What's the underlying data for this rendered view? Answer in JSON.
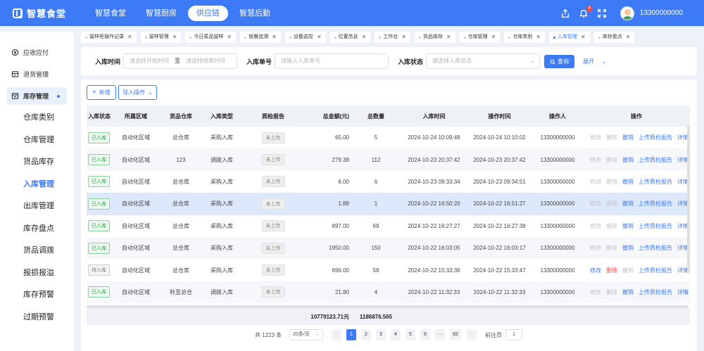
{
  "app": {
    "name": "智慧食堂"
  },
  "topnav": [
    {
      "label": "智慧食堂",
      "active": false
    },
    {
      "label": "智慧厨房",
      "active": false
    },
    {
      "label": "供应链",
      "active": true
    },
    {
      "label": "智慧后勤",
      "active": false
    }
  ],
  "header": {
    "notification_count": "4",
    "user_phone": "13300000000"
  },
  "sidebar": {
    "items": [
      {
        "label": "应收应付",
        "icon": "money-icon"
      },
      {
        "label": "退货管理",
        "icon": "return-icon"
      },
      {
        "label": "库存管理",
        "icon": "inventory-icon",
        "expanded": true
      }
    ],
    "sub_items": [
      {
        "label": "仓库类别",
        "active": false
      },
      {
        "label": "仓库管理",
        "active": false
      },
      {
        "label": "货品库存",
        "active": false
      },
      {
        "label": "入库管理",
        "active": true
      },
      {
        "label": "出库管理",
        "active": false
      },
      {
        "label": "库存盘点",
        "active": false
      },
      {
        "label": "货品调拨",
        "active": false
      },
      {
        "label": "报损报溢",
        "active": false
      },
      {
        "label": "库存预警",
        "active": false
      },
      {
        "label": "过期预警",
        "active": false
      }
    ]
  },
  "tabs": [
    {
      "label": "留样柜操作记录",
      "active": false
    },
    {
      "label": "留样管理",
      "active": false
    },
    {
      "label": "今日菜品留样",
      "active": false
    },
    {
      "label": "就餐追溯",
      "active": false
    },
    {
      "label": "设备监控",
      "active": false
    },
    {
      "label": "位置信息",
      "active": false
    },
    {
      "label": "工作台",
      "active": false
    },
    {
      "label": "货品库存",
      "active": false
    },
    {
      "label": "仓库管理",
      "active": false
    },
    {
      "label": "仓库类别",
      "active": false
    },
    {
      "label": "入库管理",
      "active": true
    },
    {
      "label": "库存盘点",
      "active": false
    }
  ],
  "search": {
    "date_label": "入库时间",
    "date_start_placeholder": "请选择开始时间",
    "date_to": "至",
    "date_end_placeholder": "请选择结束时间",
    "order_label": "入库单号",
    "order_placeholder": "请输入入库单号",
    "status_label": "入库状态",
    "status_placeholder": "请选择入库状态",
    "query_label": "查询",
    "expand_label": "展开"
  },
  "toolbar": {
    "add_label": "新增",
    "import_label": "导入操作"
  },
  "table": {
    "columns": [
      "入库状态",
      "所属区域",
      "货品仓库",
      "入库类型",
      "质检报告",
      "总金额(元)",
      "总数量",
      "入库时间",
      "操作时间",
      "操作人",
      "操作"
    ],
    "rows": [
      {
        "status": "已入库",
        "area": "自动化区域",
        "warehouse": "总仓库",
        "type": "采购入库",
        "report": "未上传",
        "amount": "65.00",
        "qty": "5",
        "in_time": "2024-10-24 10:09:48",
        "op_time": "2024-10-24 10:10:02",
        "operator": "13300000000",
        "editable": false
      },
      {
        "status": "已入库",
        "area": "自动化区域",
        "warehouse": "123",
        "type": "调拨入库",
        "report": "未上传",
        "amount": "279.38",
        "qty": "112",
        "in_time": "2024-10-23 20:37:42",
        "op_time": "2024-10-23 20:37:42",
        "operator": "13300000000",
        "editable": false
      },
      {
        "status": "已入库",
        "area": "自动化区域",
        "warehouse": "总仓库",
        "type": "采购入库",
        "report": "未上传",
        "amount": "6.00",
        "qty": "6",
        "in_time": "2024-10-23 09:33:34",
        "op_time": "2024-10-23 09:34:51",
        "operator": "13300000000",
        "editable": false
      },
      {
        "status": "已入库",
        "area": "自动化区域",
        "warehouse": "总仓库",
        "type": "采购入库",
        "report": "未上传",
        "amount": "1.88",
        "qty": "1",
        "in_time": "2024-10-22 16:50:20",
        "op_time": "2024-10-22 16:51:27",
        "operator": "13300000000",
        "editable": false
      },
      {
        "status": "已入库",
        "area": "自动化区域",
        "warehouse": "总仓库",
        "type": "采购入库",
        "report": "未上传",
        "amount": "897.00",
        "qty": "69",
        "in_time": "2024-10-22 16:27:27",
        "op_time": "2024-10-22 16:27:38",
        "operator": "13300000000",
        "editable": false
      },
      {
        "status": "已入库",
        "area": "自动化区域",
        "warehouse": "总仓库",
        "type": "采购入库",
        "report": "未上传",
        "amount": "1950.00",
        "qty": "150",
        "in_time": "2024-10-22 16:03:05",
        "op_time": "2024-10-22 16:03:17",
        "operator": "13300000000",
        "editable": false
      },
      {
        "status": "待入库",
        "area": "自动化区域",
        "warehouse": "总仓库",
        "type": "采购入库",
        "report": "未上传",
        "amount": "696.00",
        "qty": "58",
        "in_time": "2024-10-22 15:33:36",
        "op_time": "2024-10-22 15:33:47",
        "operator": "13300000000",
        "editable": true
      },
      {
        "status": "已入库",
        "area": "自动化区域",
        "warehouse": "秋至总仓",
        "type": "调拨入库",
        "report": "未上传",
        "amount": "21.80",
        "qty": "4",
        "in_time": "2024-10-22 11:32:33",
        "op_time": "2024-10-22 11:32:33",
        "operator": "13300000000",
        "editable": false
      }
    ],
    "ops": {
      "edit": "修改",
      "delete": "删除",
      "revoke": "撤销",
      "upload": "上传质检报告",
      "detail": "详情"
    },
    "summary": {
      "amount": "10779123.71元",
      "qty": "1186876.565"
    }
  },
  "pagination": {
    "total": "共 1223 条",
    "page_size": "20条/页",
    "pages": [
      "1",
      "2",
      "3",
      "4",
      "5",
      "6",
      "···",
      "62"
    ],
    "current": "1",
    "goto_label": "前往页",
    "goto_value": "1"
  },
  "colors": {
    "accent": "#3d7af5",
    "danger": "#f04848",
    "success": "#2fa84a"
  }
}
